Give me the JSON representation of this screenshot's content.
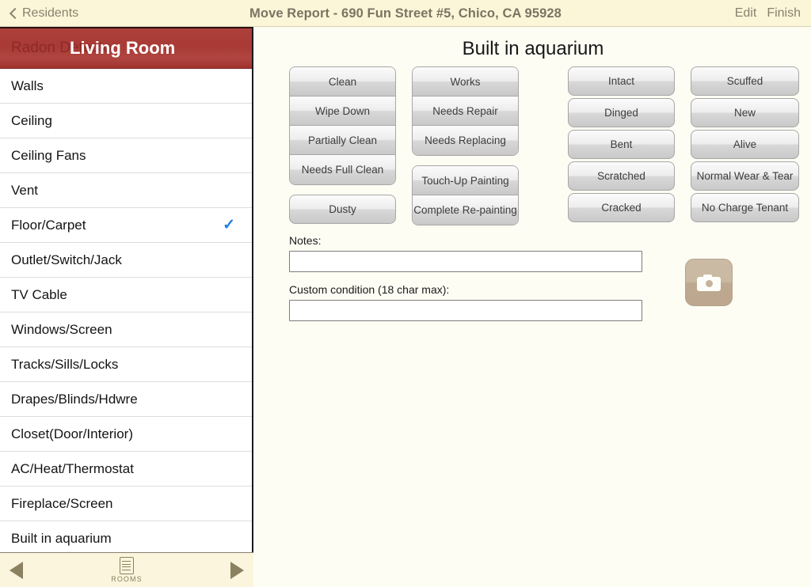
{
  "topbar": {
    "back_label": "Residents",
    "title": "Move Report - 690 Fun Street #5, Chico, CA 95928",
    "edit_label": "Edit",
    "finish_label": "Finish"
  },
  "sidebar": {
    "header": {
      "ghost_title": "Radon Detector",
      "title": "Living Room"
    },
    "items": [
      {
        "label": "Walls",
        "checked": false
      },
      {
        "label": "Ceiling",
        "checked": false
      },
      {
        "label": "Ceiling Fans",
        "checked": false
      },
      {
        "label": "Vent",
        "checked": false
      },
      {
        "label": "Floor/Carpet",
        "checked": true
      },
      {
        "label": "Outlet/Switch/Jack",
        "checked": false
      },
      {
        "label": "TV Cable",
        "checked": false
      },
      {
        "label": "Windows/Screen",
        "checked": false
      },
      {
        "label": "Tracks/Sills/Locks",
        "checked": false
      },
      {
        "label": "Drapes/Blinds/Hdwre",
        "checked": false
      },
      {
        "label": "Closet(Door/Interior)",
        "checked": false
      },
      {
        "label": "AC/Heat/Thermostat",
        "checked": false
      },
      {
        "label": "Fireplace/Screen",
        "checked": false
      },
      {
        "label": "Built in aquarium",
        "checked": false
      }
    ],
    "check_glyph": "✓",
    "check_color": "#1a7fe0"
  },
  "bottombar": {
    "prev_label": "previous-arrow",
    "next_label": "next-arrow",
    "rooms_label": "ROOMS"
  },
  "main": {
    "title": "Built in aquarium",
    "columns": [
      {
        "name": "cleanliness",
        "groups": [
          {
            "type": "segmented",
            "options": [
              "Clean",
              "Wipe Down",
              "Partially Clean",
              "Needs Full Clean"
            ]
          },
          {
            "type": "single",
            "options": [
              "Dusty"
            ]
          }
        ]
      },
      {
        "name": "function",
        "groups": [
          {
            "type": "segmented",
            "options": [
              "Works",
              "Needs Repair",
              "Needs Replacing"
            ]
          },
          {
            "type": "segmented",
            "options": [
              "Touch-Up Painting",
              "Complete Re-painting"
            ]
          }
        ]
      },
      {
        "name": "damage",
        "groups": [
          {
            "type": "single",
            "options": [
              "Intact"
            ]
          },
          {
            "type": "single",
            "options": [
              "Dinged"
            ]
          },
          {
            "type": "single",
            "options": [
              "Bent"
            ]
          },
          {
            "type": "single",
            "options": [
              "Scratched"
            ]
          },
          {
            "type": "single",
            "options": [
              "Cracked"
            ]
          }
        ]
      },
      {
        "name": "condition",
        "groups": [
          {
            "type": "single",
            "options": [
              "Scuffed"
            ]
          },
          {
            "type": "single",
            "options": [
              "New"
            ]
          },
          {
            "type": "single",
            "options": [
              "Alive"
            ]
          },
          {
            "type": "single",
            "options": [
              "Normal Wear & Tear"
            ]
          },
          {
            "type": "single",
            "options": [
              "No Charge Tenant"
            ]
          }
        ]
      }
    ],
    "form": {
      "notes_label": "Notes:",
      "notes_value": "",
      "notes_placeholder": "",
      "custom_label": "Custom condition (18 char max):",
      "custom_value": "",
      "custom_placeholder": ""
    },
    "camera_icon": "camera-icon"
  },
  "colors": {
    "topbar_bg": "#fbf6d8",
    "room_header_red": "#a93a36",
    "accent_blue": "#1a7fe0",
    "panel_bg": "#fdfdf4",
    "toolbar_tan": "#8b8161",
    "camera_tan": "#c5b49c"
  }
}
